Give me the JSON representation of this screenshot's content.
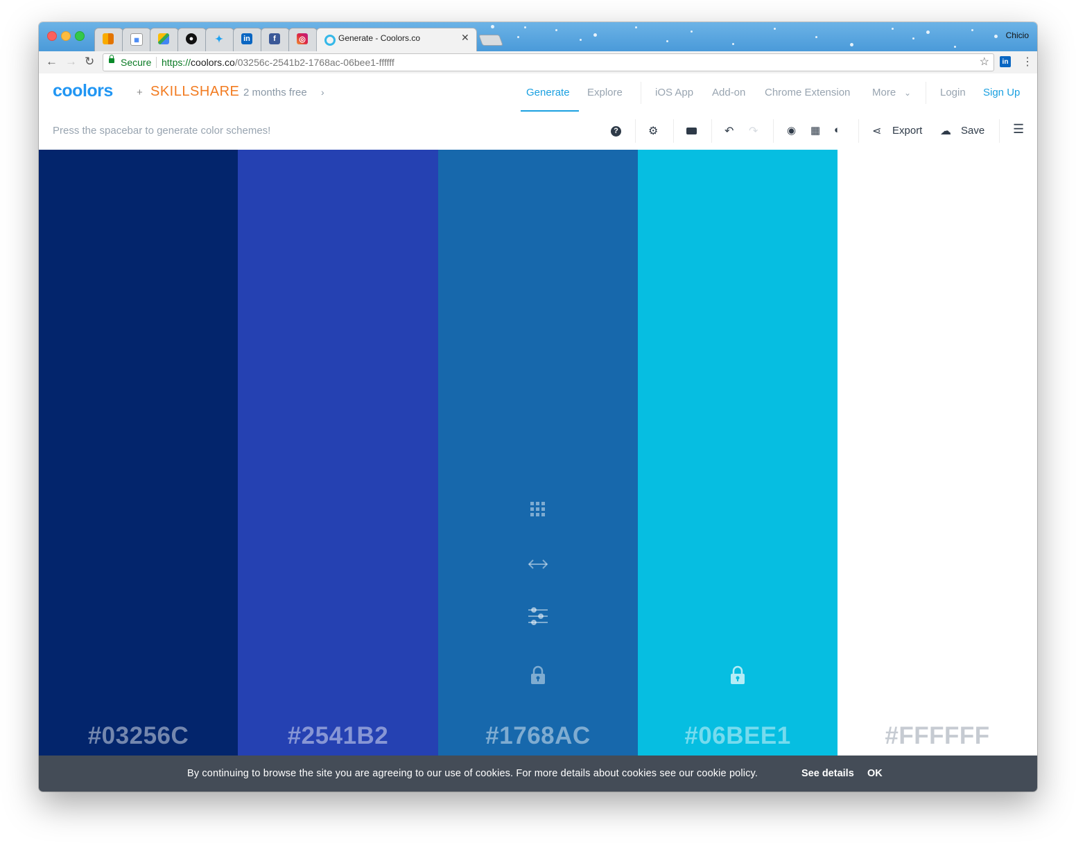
{
  "browser": {
    "active_tab_title": "Generate - Coolors.co",
    "profile_name": "Chicio",
    "secure_label": "Secure",
    "url_scheme": "https://",
    "url_host": "coolors.co",
    "url_path": "/03256c-2541b2-1768ac-06bee1-ffffff",
    "extension": "in"
  },
  "header": {
    "logo": "coolors",
    "plus": "+",
    "partner": "SKILLSHARE",
    "promo": "2 months free",
    "nav": {
      "generate": "Generate",
      "explore": "Explore",
      "ios_app": "iOS App",
      "addon": "Add-on",
      "chrome_extension": "Chrome Extension",
      "more": "More",
      "login": "Login",
      "signup": "Sign Up"
    }
  },
  "toolbar": {
    "hint": "Press the spacebar to generate color schemes!",
    "export_label": "Export",
    "save_label": "Save"
  },
  "palette": [
    {
      "hex": "#03256C",
      "color": "#03256c"
    },
    {
      "hex": "#2541B2",
      "color": "#2541b2"
    },
    {
      "hex": "#1768AC",
      "color": "#1768ac"
    },
    {
      "hex": "#06BEE1",
      "color": "#06bee1"
    },
    {
      "hex": "#FFFFFF",
      "color": "#ffffff"
    }
  ],
  "cookie": {
    "text": "By continuing to browse the site you are agreeing to our use of cookies. For more details about cookies see our cookie policy.",
    "details": "See details",
    "ok": "OK"
  },
  "colors": {
    "accent": "#1aa0e0",
    "partner": "#f27b20",
    "cookie_bg": "#444c57"
  }
}
